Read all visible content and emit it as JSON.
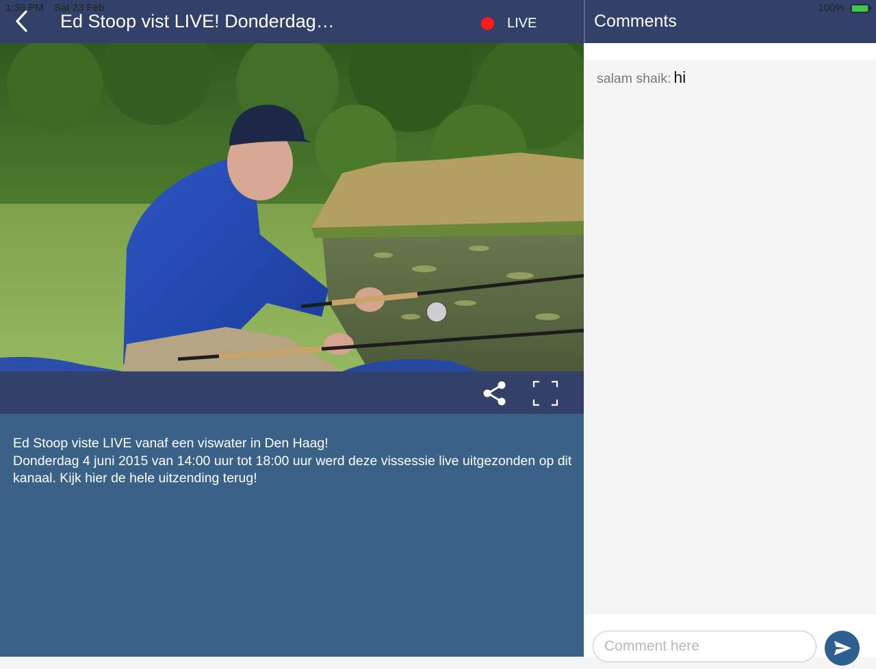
{
  "status_bar": {
    "time": "1:39 PM",
    "date": "Sat 23 Feb",
    "battery_percent": "100%",
    "battery_level": 1.0
  },
  "header": {
    "back_icon": "chevron-left-icon",
    "title": "Ed Stoop vist LIVE! Donderdag…",
    "live_indicator_color": "#ff1a1a",
    "live_label": "LIVE"
  },
  "video": {
    "description": "fishing livestream video frame"
  },
  "controls": {
    "share_icon": "share-icon",
    "fullscreen_icon": "fullscreen-icon"
  },
  "description": {
    "line1": "Ed Stoop viste LIVE vanaf een viswater in Den Haag!",
    "line2": "Donderdag 4 juni 2015 van 14:00 uur tot 18:00 uur werd deze vissessie live uitgezonden op dit kanaal. Kijk hier de hele uitzending terug!"
  },
  "comments": {
    "title": "Comments",
    "items": [
      {
        "user": "salam shaik:",
        "text": "hi"
      }
    ],
    "input_placeholder": "Comment here",
    "send_icon": "send-icon"
  },
  "colors": {
    "header_bg": "#33416a",
    "description_bg": "#3a6289",
    "send_button": "#2e5f93"
  }
}
